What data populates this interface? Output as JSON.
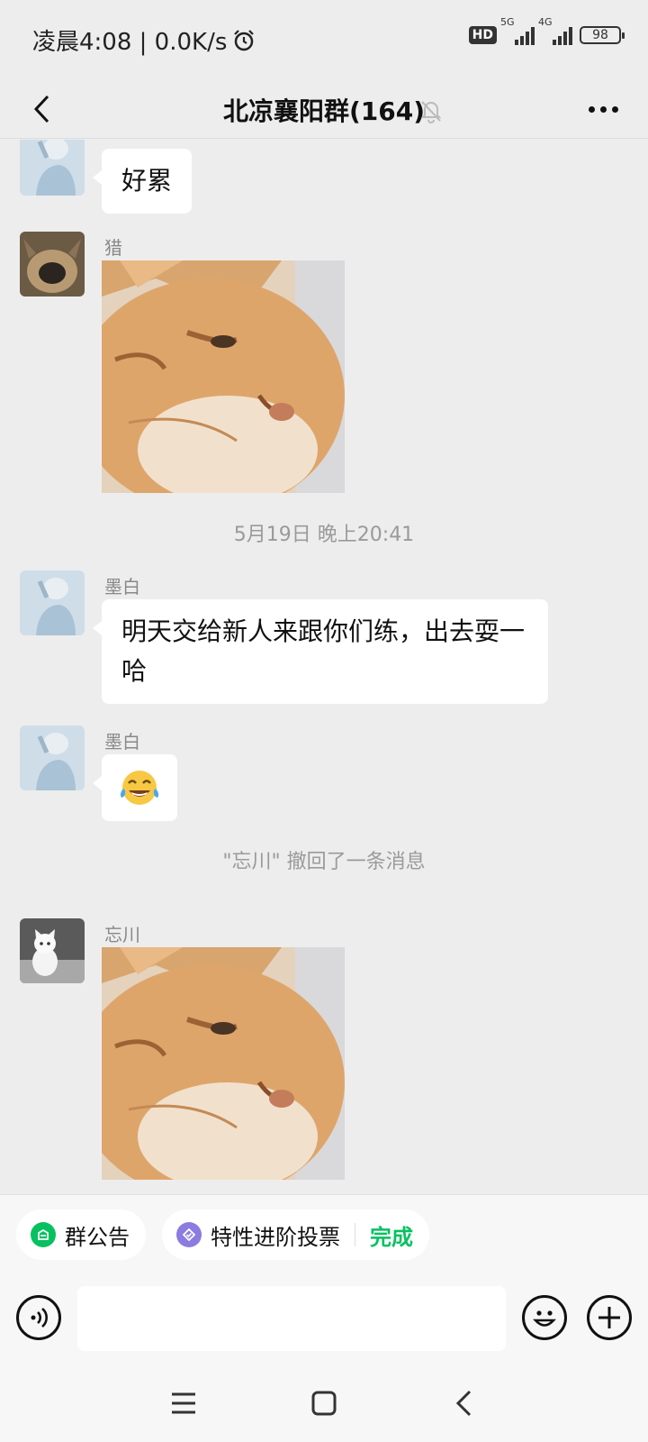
{
  "status_bar": {
    "time_speed": "凌晨4:08 | 0.0K/s",
    "hd": "HD",
    "net1": "5G",
    "net2": "4G",
    "battery": "98"
  },
  "header": {
    "title": "北凉襄阳群(164)"
  },
  "messages": {
    "m0_text": "好累",
    "m1_sender": "猎",
    "timestamp": "5月19日 晚上20:41",
    "m2_sender": "墨白",
    "m2_text": "明天交给新人来跟你们练，出去耍一哈",
    "m3_sender": "墨白",
    "m3_text": "😂",
    "recall_notice": "\"忘川\" 撤回了一条消息",
    "m4_sender": "忘川"
  },
  "shortcuts": {
    "announcement": "群公告",
    "vote": "特性进阶投票",
    "vote_status": "完成"
  },
  "colors": {
    "accent_green": "#07c160",
    "vote_purple": "#8c7be0"
  }
}
